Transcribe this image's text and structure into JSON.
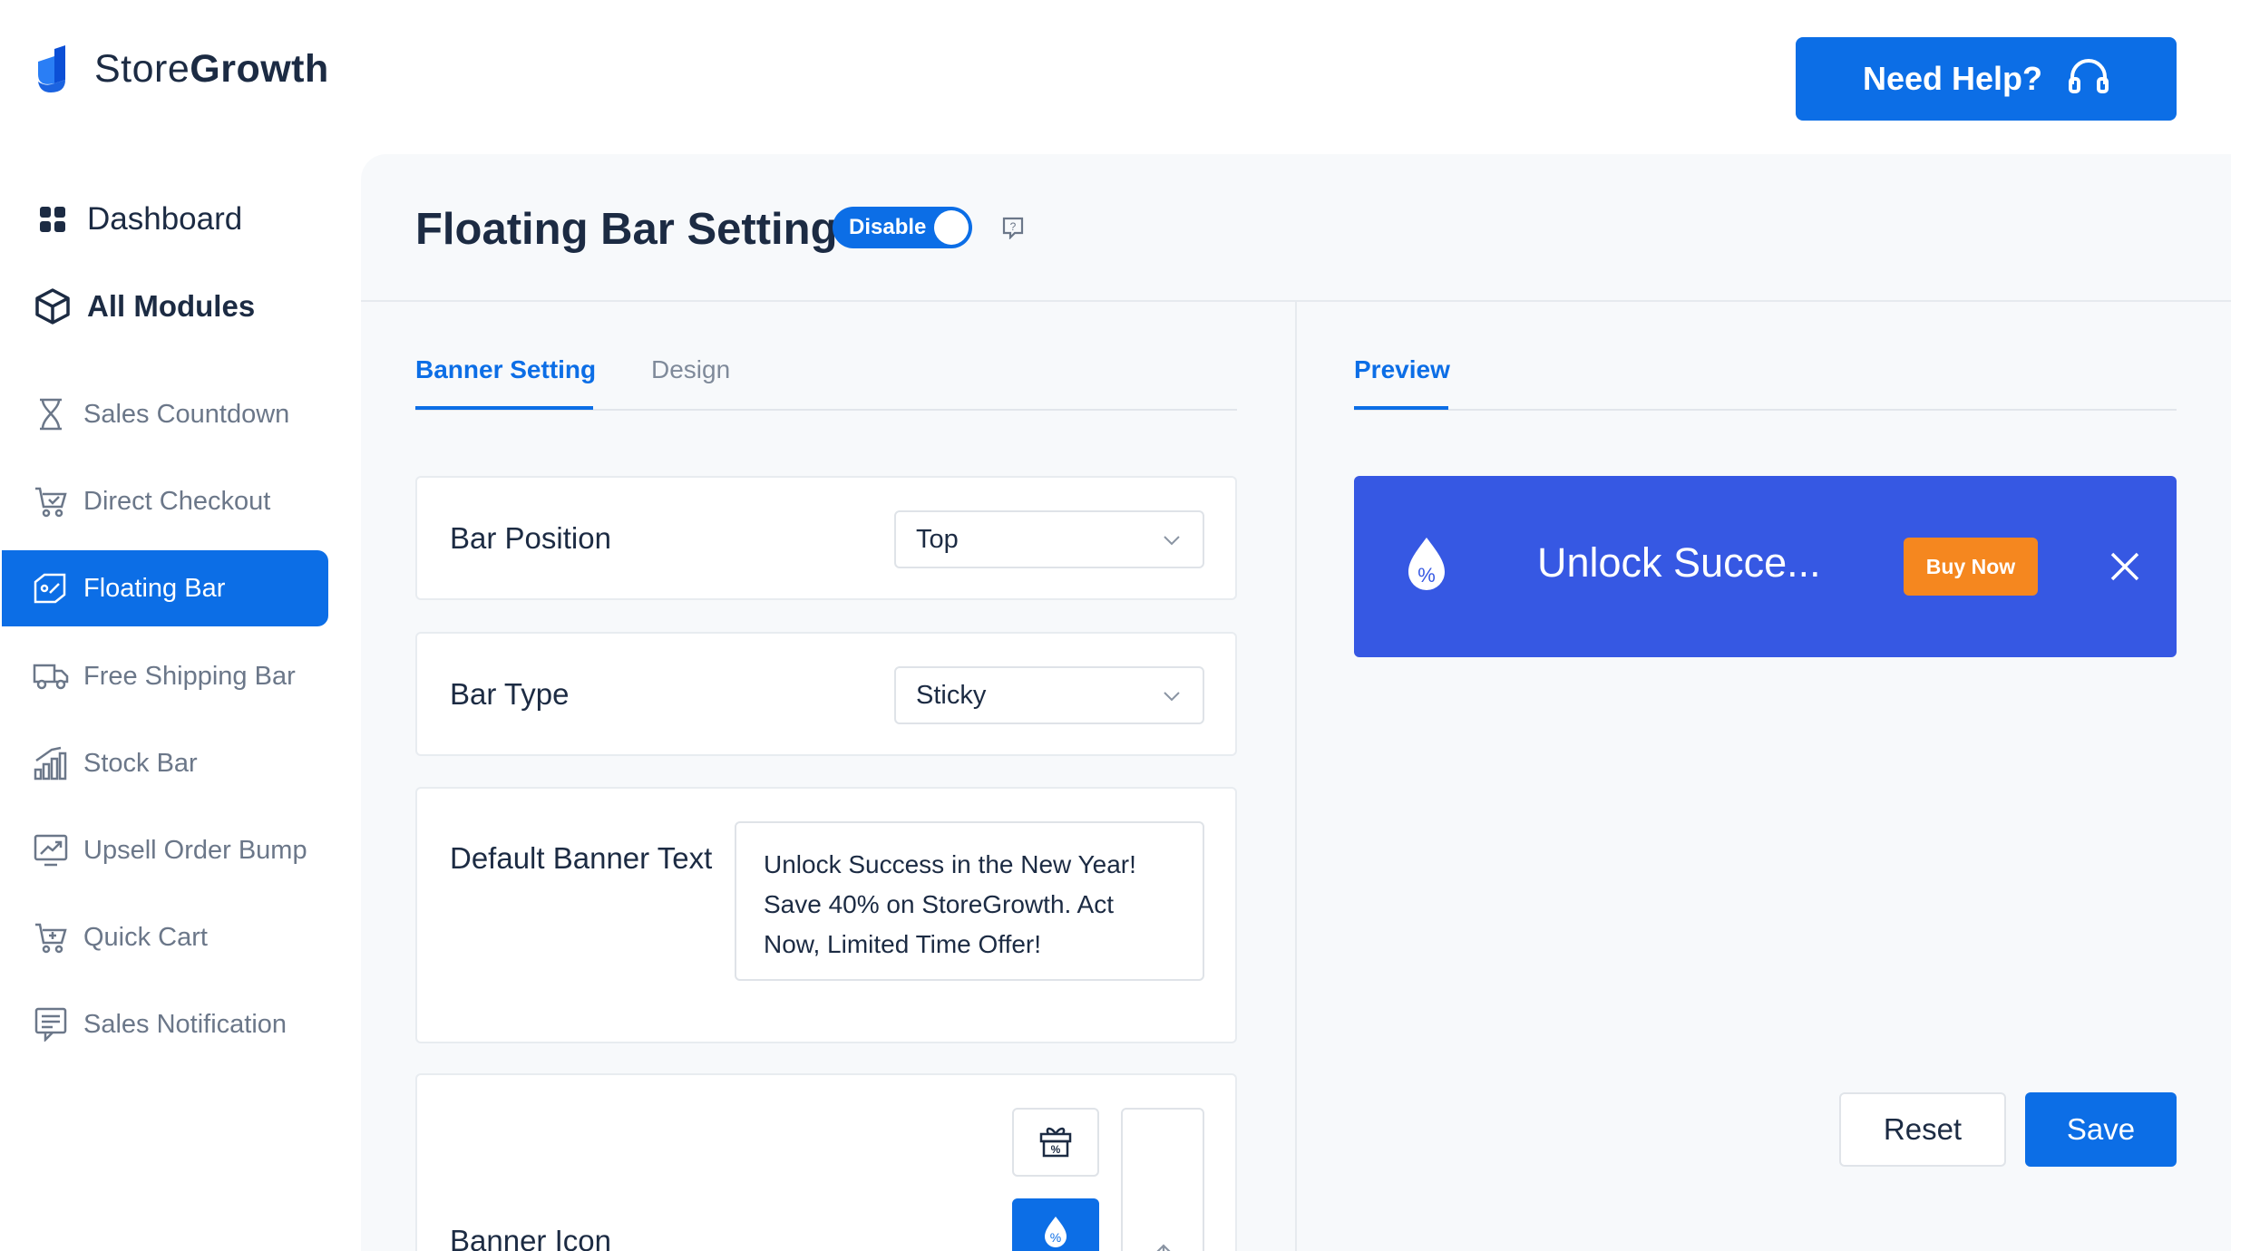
{
  "brand": {
    "name_part1": "Store",
    "name_part2": "Growth"
  },
  "header": {
    "help_label": "Need Help?"
  },
  "sidebar": {
    "main": [
      {
        "label": "Dashboard",
        "icon": "dashboard-grid-icon"
      },
      {
        "label": "All Modules",
        "icon": "cube-icon"
      }
    ],
    "items": [
      {
        "label": "Sales Countdown",
        "icon": "hourglass-icon"
      },
      {
        "label": "Direct Checkout",
        "icon": "cart-check-icon"
      },
      {
        "label": "Floating Bar",
        "icon": "tag-icon",
        "active": true
      },
      {
        "label": "Free Shipping Bar",
        "icon": "truck-icon"
      },
      {
        "label": "Stock Bar",
        "icon": "bar-chart-icon"
      },
      {
        "label": "Upsell Order Bump",
        "icon": "trend-up-icon"
      },
      {
        "label": "Quick Cart",
        "icon": "cart-icon"
      },
      {
        "label": "Sales Notification",
        "icon": "notification-icon"
      }
    ]
  },
  "page": {
    "title": "Floating Bar Setting",
    "toggle_label": "Disable"
  },
  "tabs": {
    "settings": [
      {
        "label": "Banner Setting",
        "active": true
      },
      {
        "label": "Design",
        "active": false
      }
    ],
    "preview": {
      "label": "Preview",
      "active": true
    }
  },
  "form": {
    "bar_position": {
      "label": "Bar Position",
      "value": "Top"
    },
    "bar_type": {
      "label": "Bar Type",
      "value": "Sticky"
    },
    "banner_text": {
      "label": "Default Banner Text",
      "value": "Unlock Success in the New Year! Save 40% on StoreGrowth. Act Now, Limited Time Offer!"
    },
    "banner_icon": {
      "label": "Banner Icon"
    }
  },
  "preview": {
    "text": "Unlock Succe...",
    "button_label": "Buy Now",
    "bg_color": "#3658e3",
    "button_color": "#f5871f"
  },
  "actions": {
    "reset_label": "Reset",
    "save_label": "Save"
  },
  "colors": {
    "accent": "#0c6ee6"
  }
}
